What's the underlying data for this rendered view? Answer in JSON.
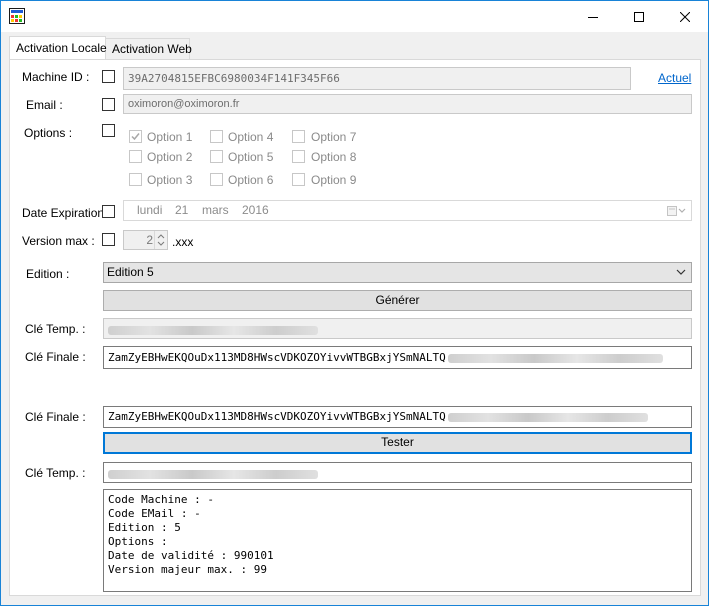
{
  "tabs": [
    {
      "label": "Activation Locale"
    },
    {
      "label": "Activation Web"
    }
  ],
  "form": {
    "machine_id": {
      "label": "Machine ID :",
      "value": "39A2704815EFBC6980034F141F345F66",
      "link": "Actuel"
    },
    "email": {
      "label": "Email :",
      "value": "oximoron@oximoron.fr"
    },
    "options": {
      "label": "Options :",
      "items": [
        "Option 1",
        "Option 2",
        "Option 3",
        "Option 4",
        "Option 5",
        "Option 6",
        "Option 7",
        "Option 8",
        "Option 9"
      ]
    },
    "date_expiration": {
      "label": "Date Expiration :",
      "weekday": "lundi",
      "day": "21",
      "month": "mars",
      "year": "2016"
    },
    "version_max": {
      "label": "Version max :",
      "value": "2",
      "suffix": ".xxx"
    },
    "edition": {
      "label": "Edition :",
      "value": "Edition 5"
    },
    "generate_label": "Générer",
    "cle_temp_label": "Clé Temp. :",
    "cle_finale_label": "Clé Finale :",
    "cle_finale_value": "ZamZyEBHwEKQOuDx113MD8HWscVDKOZOYivvWTBGBxjYSmNALTQ"
  },
  "test": {
    "cle_finale_label": "Clé Finale :",
    "cle_finale_value": "ZamZyEBHwEKQOuDx113MD8HWscVDKOZOYivvWTBGBxjYSmNALTQ",
    "tester_label": "Tester",
    "cle_temp_label": "Clé Temp. :",
    "result_lines": [
      "Code Machine : -",
      "Code EMail : -",
      "Edition : 5",
      "Options :",
      "Date de validité : 990101",
      "Version majeur max. : 99"
    ]
  },
  "colors": {
    "accent": "#0078d7",
    "link": "#0066cc"
  }
}
